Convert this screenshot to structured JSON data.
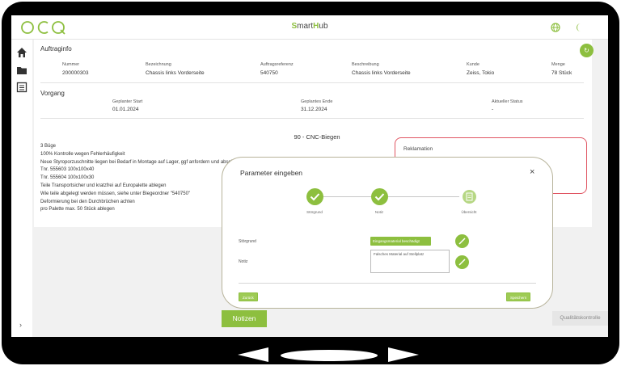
{
  "header": {
    "logo_text": "OCQ",
    "app_title_s": "S",
    "app_title_mart": "mart",
    "app_title_h": "H",
    "app_title_ub": "ub"
  },
  "icons": {
    "globe": "globe-icon",
    "theme": "moon-icon",
    "home": "home-icon",
    "folder": "folder-icon",
    "list": "list-icon",
    "refresh": "refresh-icon",
    "chevron": "chevron-right-icon"
  },
  "colors": {
    "accent": "#8dbf3f",
    "alert": "#e05562"
  },
  "auftraginfo": {
    "title": "Auftraginfo",
    "fields": [
      {
        "label": "Nummer",
        "value": "200000303"
      },
      {
        "label": "Bezeichnung",
        "value": "Chassis links Vorderseite"
      },
      {
        "label": "Auftragsreferenz",
        "value": "540750"
      },
      {
        "label": "Beschreibung",
        "value": "Chassis links Vorderseite"
      },
      {
        "label": "Kunde",
        "value": "Zeiss, Tokio"
      },
      {
        "label": "Menge",
        "value": "78 Stück"
      }
    ]
  },
  "vorgang": {
    "title": "Vorgang",
    "fields": [
      {
        "label": "Geplanter Start",
        "value": "01.01.2024"
      },
      {
        "label": "Geplantes Ende",
        "value": "31.12.2024"
      },
      {
        "label": "Aktueller Status",
        "value": "-"
      }
    ],
    "operation_title": "90 - CNC-Biegen",
    "description": [
      "3 Büge",
      "100% Kontrolle wegen Fehlerhäufigkeit",
      "Neue Styroporzuschnitte liegen bei Bedarf in Montage auf Lager, ggf anfordern und abschreiben",
      "Tnr. 555603 100x100x40",
      "Tnr. 555604 100x100x30",
      "Teile Transportsicher und kratzfrei auf Europalette ablegen",
      "Wie teile abgelegt werden müssen, siehe unter Biegeordner \"540750\"",
      "Deformierung bei den Durchbrüchen achten",
      "pro Palette max. 50 Stück ablegen"
    ],
    "reklamation_label": "Reklamation"
  },
  "buttons": {
    "notizen": "Notizen",
    "qualitaetskontrolle": "Qualitätskontrolle"
  },
  "modal": {
    "title": "Parameter eingeben",
    "close": "×",
    "steps": [
      {
        "label": "Störgrund",
        "state": "done"
      },
      {
        "label": "Notiz",
        "state": "done"
      },
      {
        "label": "Übersicht",
        "state": "current"
      }
    ],
    "stoergrund_label": "Störgrund",
    "stoergrund_value": "Eingangsmaterial beschädigt",
    "notiz_label": "Notiz",
    "notiz_value": "Falsches Material auf Stellplatz",
    "back_label": "Zurück",
    "save_label": "Speichern"
  }
}
